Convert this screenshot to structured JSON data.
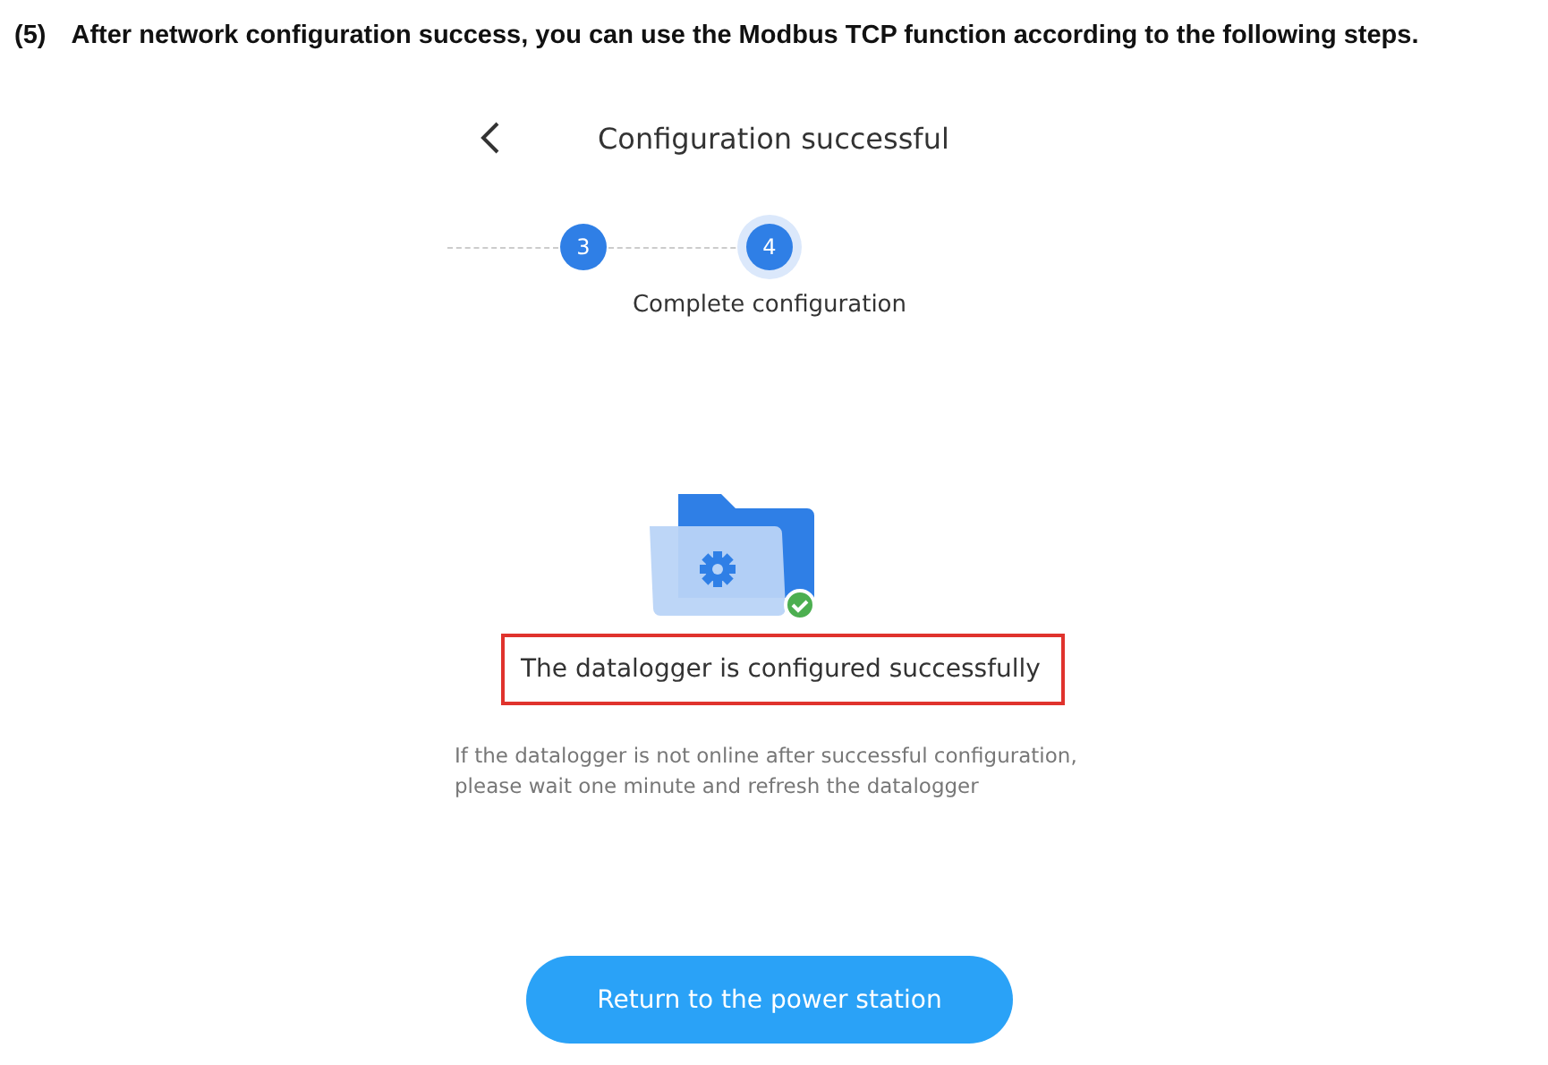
{
  "instruction": {
    "number": "(5)",
    "text": "After network configuration success, you can use the Modbus TCP function according to the following steps."
  },
  "screen": {
    "title": "Configuration successful",
    "steps": [
      {
        "number": "3",
        "selected": false
      },
      {
        "number": "4",
        "selected": true,
        "label": "Complete configuration"
      }
    ],
    "status_message": {
      "text": "The datalogger is configured successfully",
      "highlighted": true
    },
    "note": "If the datalogger is not online after successful configuration,\nplease wait one minute and refresh the datalogger",
    "button": "Return to the power station"
  }
}
